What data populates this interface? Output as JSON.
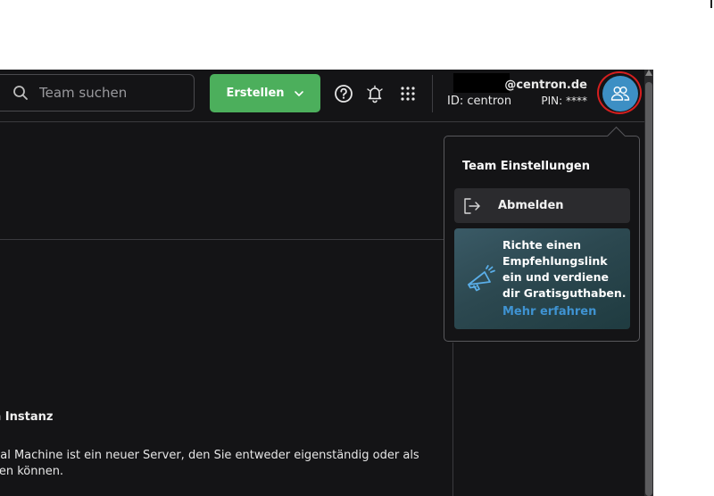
{
  "header": {
    "search": {
      "placeholder": "Team suchen",
      "icon": "search-icon"
    },
    "create_button": {
      "label": "Erstellen",
      "icon": "chevron-down-icon",
      "color": "#4caf5c"
    },
    "icons": [
      "help-icon",
      "bell-icon",
      "apps-grid-icon"
    ],
    "account": {
      "email": "@centron.de",
      "id": "ID: centron",
      "pin": "PIN: ****"
    },
    "avatar": {
      "icon": "users-icon",
      "color": "#3d8fc4",
      "highlight_color": "#d61f1f"
    }
  },
  "content": {
    "heading": "n Instanz",
    "text": "ual Machine ist ein neuer Server, den Sie entweder eigenständig oder als zen können."
  },
  "dropdown": {
    "title": "Team Einstellungen",
    "logout": {
      "label": "Abmelden",
      "icon": "logout-icon"
    },
    "promo": {
      "icon": "megaphone-icon",
      "text": "Richte einen Empfehlungslink ein und verdiene dir Gratisguthaben.",
      "link": "Mehr erfahren",
      "link_color": "#3f93d2"
    }
  }
}
